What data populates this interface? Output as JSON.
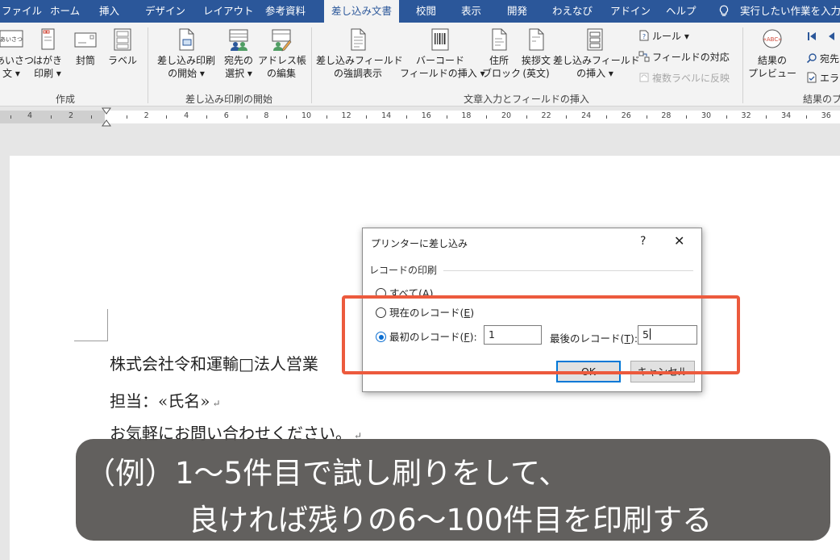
{
  "tabs": [
    {
      "label": "ファイル",
      "active": false
    },
    {
      "label": "ホーム",
      "active": false
    },
    {
      "label": "挿入",
      "active": false
    },
    {
      "label": "デザイン",
      "active": false
    },
    {
      "label": "レイアウト",
      "active": false
    },
    {
      "label": "参考資料",
      "active": false
    },
    {
      "label": "差し込み文書",
      "active": true
    },
    {
      "label": "校閲",
      "active": false
    },
    {
      "label": "表示",
      "active": false
    },
    {
      "label": "開発",
      "active": false
    },
    {
      "label": "わえなび",
      "active": false
    },
    {
      "label": "アドイン",
      "active": false
    },
    {
      "label": "ヘルプ",
      "active": false
    }
  ],
  "tellme": "実行したい作業を入力し",
  "ribbon": {
    "create": {
      "label": "作成",
      "greeting": {
        "icon_text": "あいさつ",
        "line1": "あいさつ",
        "line2": "文 ▾"
      },
      "postcard": {
        "line1": "はがき",
        "line2": "印刷 ▾"
      },
      "envelope": {
        "line1": "封筒"
      },
      "labels": {
        "line1": "ラベル"
      }
    },
    "start": {
      "label": "差し込み印刷の開始",
      "start_merge": {
        "line1": "差し込み印刷",
        "line2": "の開始 ▾"
      },
      "recipients": {
        "line1": "宛先の",
        "line2": "選択 ▾"
      },
      "edit_list": {
        "line1": "アドレス帳",
        "line2": "の編集"
      }
    },
    "fields": {
      "label": "文章入力とフィールドの挿入",
      "highlight": {
        "line1": "差し込みフィールド",
        "line2": "の強調表示"
      },
      "barcode": {
        "line1": "バーコード",
        "line2": "フィールドの挿入 ▾"
      },
      "address_block": {
        "line1": "住所",
        "line2": "ブロック"
      },
      "greeting_line": {
        "line1": "挨拶文",
        "line2": "(英文)"
      },
      "insert_field": {
        "line1": "差し込みフィールド",
        "line2": "の挿入 ▾"
      },
      "rules": "ルール ▾",
      "match_fields": "フィールドの対応",
      "update_labels": "複数ラベルに反映"
    },
    "preview": {
      "label": "結果のプ",
      "preview_results": {
        "icon_text": "«ABC»",
        "line1": "結果の",
        "line2": "プレビュー"
      },
      "find_recipient": "宛先",
      "check_errors": "エラー"
    }
  },
  "ruler": {
    "left_labels": [
      "4",
      "2"
    ],
    "labels": [
      "2",
      "4",
      "6",
      "8",
      "10",
      "12",
      "14",
      "16",
      "18",
      "20",
      "22",
      "24",
      "26",
      "28",
      "30",
      "32",
      "34",
      "36"
    ]
  },
  "document": {
    "line1": "株式会社令和運輸□法人営業",
    "line2": "担当：«氏名»",
    "line3": "お気軽にお問い合わせください。",
    "para_mark": "↵"
  },
  "dialog": {
    "title": "プリンターに差し込み",
    "help": "?",
    "close": "✕",
    "group_label": "レコードの印刷",
    "all_label": "すべて(",
    "all_key": "A",
    "current_label": "現在のレコード(",
    "current_key": "E",
    "from_label": "最初のレコード(",
    "from_key": "F",
    "paren_close": "):",
    "paren_close_plain": ")",
    "from_value": "1",
    "to_label": "最後のレコード(",
    "to_key": "T",
    "to_value": "5",
    "selected": "from",
    "ok": "OK",
    "cancel": "キャンセル"
  },
  "caption": {
    "line1": "（例）1～5件目で試し刷りをして、",
    "line2": "良ければ残りの6～100件目を印刷する"
  },
  "colors": {
    "tabbar": "#2b579a",
    "accent": "#0078d7",
    "highlight": "#ec5a3d",
    "caption_bg": "#555250"
  }
}
